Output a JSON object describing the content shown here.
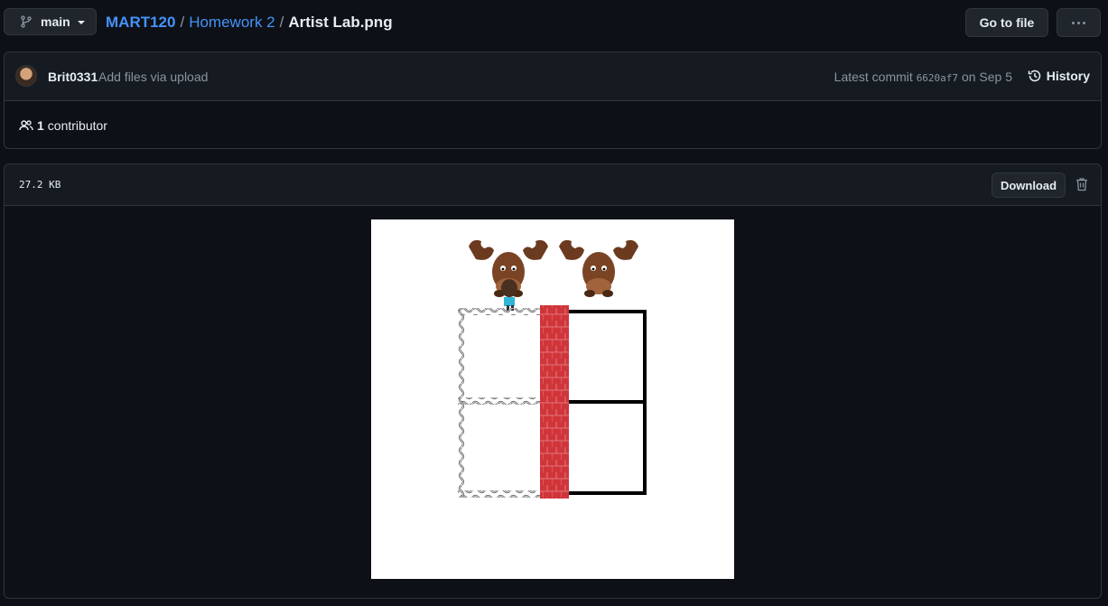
{
  "header": {
    "branch": "main",
    "breadcrumb": {
      "repo": "MART120",
      "folder": "Homework 2",
      "file": "Artist Lab.png",
      "separator": "/"
    },
    "go_to_file": "Go to file"
  },
  "commit": {
    "author": "Brit0331",
    "message": "Add files via upload",
    "latest_label": "Latest commit",
    "sha": "6620af7",
    "date": "on Sep 5",
    "history_label": "History"
  },
  "contributors": {
    "count": "1",
    "label": "contributor"
  },
  "file": {
    "size": "27.2 KB",
    "download_label": "Download"
  },
  "colors": {
    "background": "#0d1117",
    "panel": "#161b22",
    "border": "#30363d",
    "link": "#4493f8",
    "brick": "#c9302c",
    "moose": "#6b3a1f"
  },
  "icons": {
    "branch": "git-branch-icon",
    "clock": "history-clock-icon",
    "people": "people-icon",
    "trash": "trash-icon",
    "more": "kebab-horizontal-icon"
  }
}
